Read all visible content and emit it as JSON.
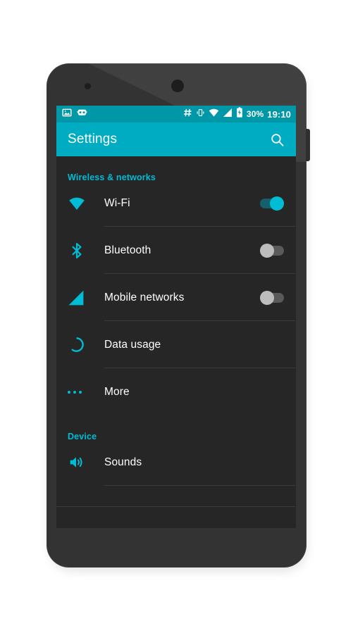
{
  "device": {
    "frame_color": "#333333",
    "screen_bg": "#262626"
  },
  "status_bar": {
    "background": "#0097a7",
    "left_icons": [
      {
        "name": "screenshot-icon",
        "label": "Screenshot"
      },
      {
        "name": "cyanogenmod-icon",
        "label": "CyanogenMod"
      }
    ],
    "right_icons": [
      {
        "name": "hash-icon",
        "label": "#"
      },
      {
        "name": "vibrate-icon",
        "label": "Vibrate"
      },
      {
        "name": "wifi-icon",
        "label": "Wi-Fi signal"
      },
      {
        "name": "cellular-signal-icon",
        "label": "Cellular signal"
      },
      {
        "name": "battery-charging-icon",
        "label": "Battery charging"
      }
    ],
    "battery_percent": "30%",
    "clock": "19:10"
  },
  "action_bar": {
    "background": "#00acc1",
    "title": "Settings",
    "search_icon": "search-icon"
  },
  "accent_color": "#00bcd4",
  "settings": {
    "sections": [
      {
        "header": "Wireless & networks",
        "items": [
          {
            "label": "Wi-Fi",
            "icon": "wifi-icon",
            "control": "toggle",
            "toggle_state": "on"
          },
          {
            "label": "Bluetooth",
            "icon": "bluetooth-icon",
            "control": "toggle",
            "toggle_state": "off"
          },
          {
            "label": "Mobile networks",
            "icon": "cellular-signal-icon",
            "control": "toggle",
            "toggle_state": "off"
          },
          {
            "label": "Data usage",
            "icon": "data-usage-icon",
            "control": "none",
            "toggle_state": ""
          },
          {
            "label": "More",
            "icon": "more-dots-icon",
            "control": "none",
            "toggle_state": ""
          }
        ]
      },
      {
        "header": "Device",
        "items": [
          {
            "label": "Sounds",
            "icon": "volume-icon",
            "control": "none",
            "toggle_state": ""
          }
        ]
      }
    ]
  }
}
